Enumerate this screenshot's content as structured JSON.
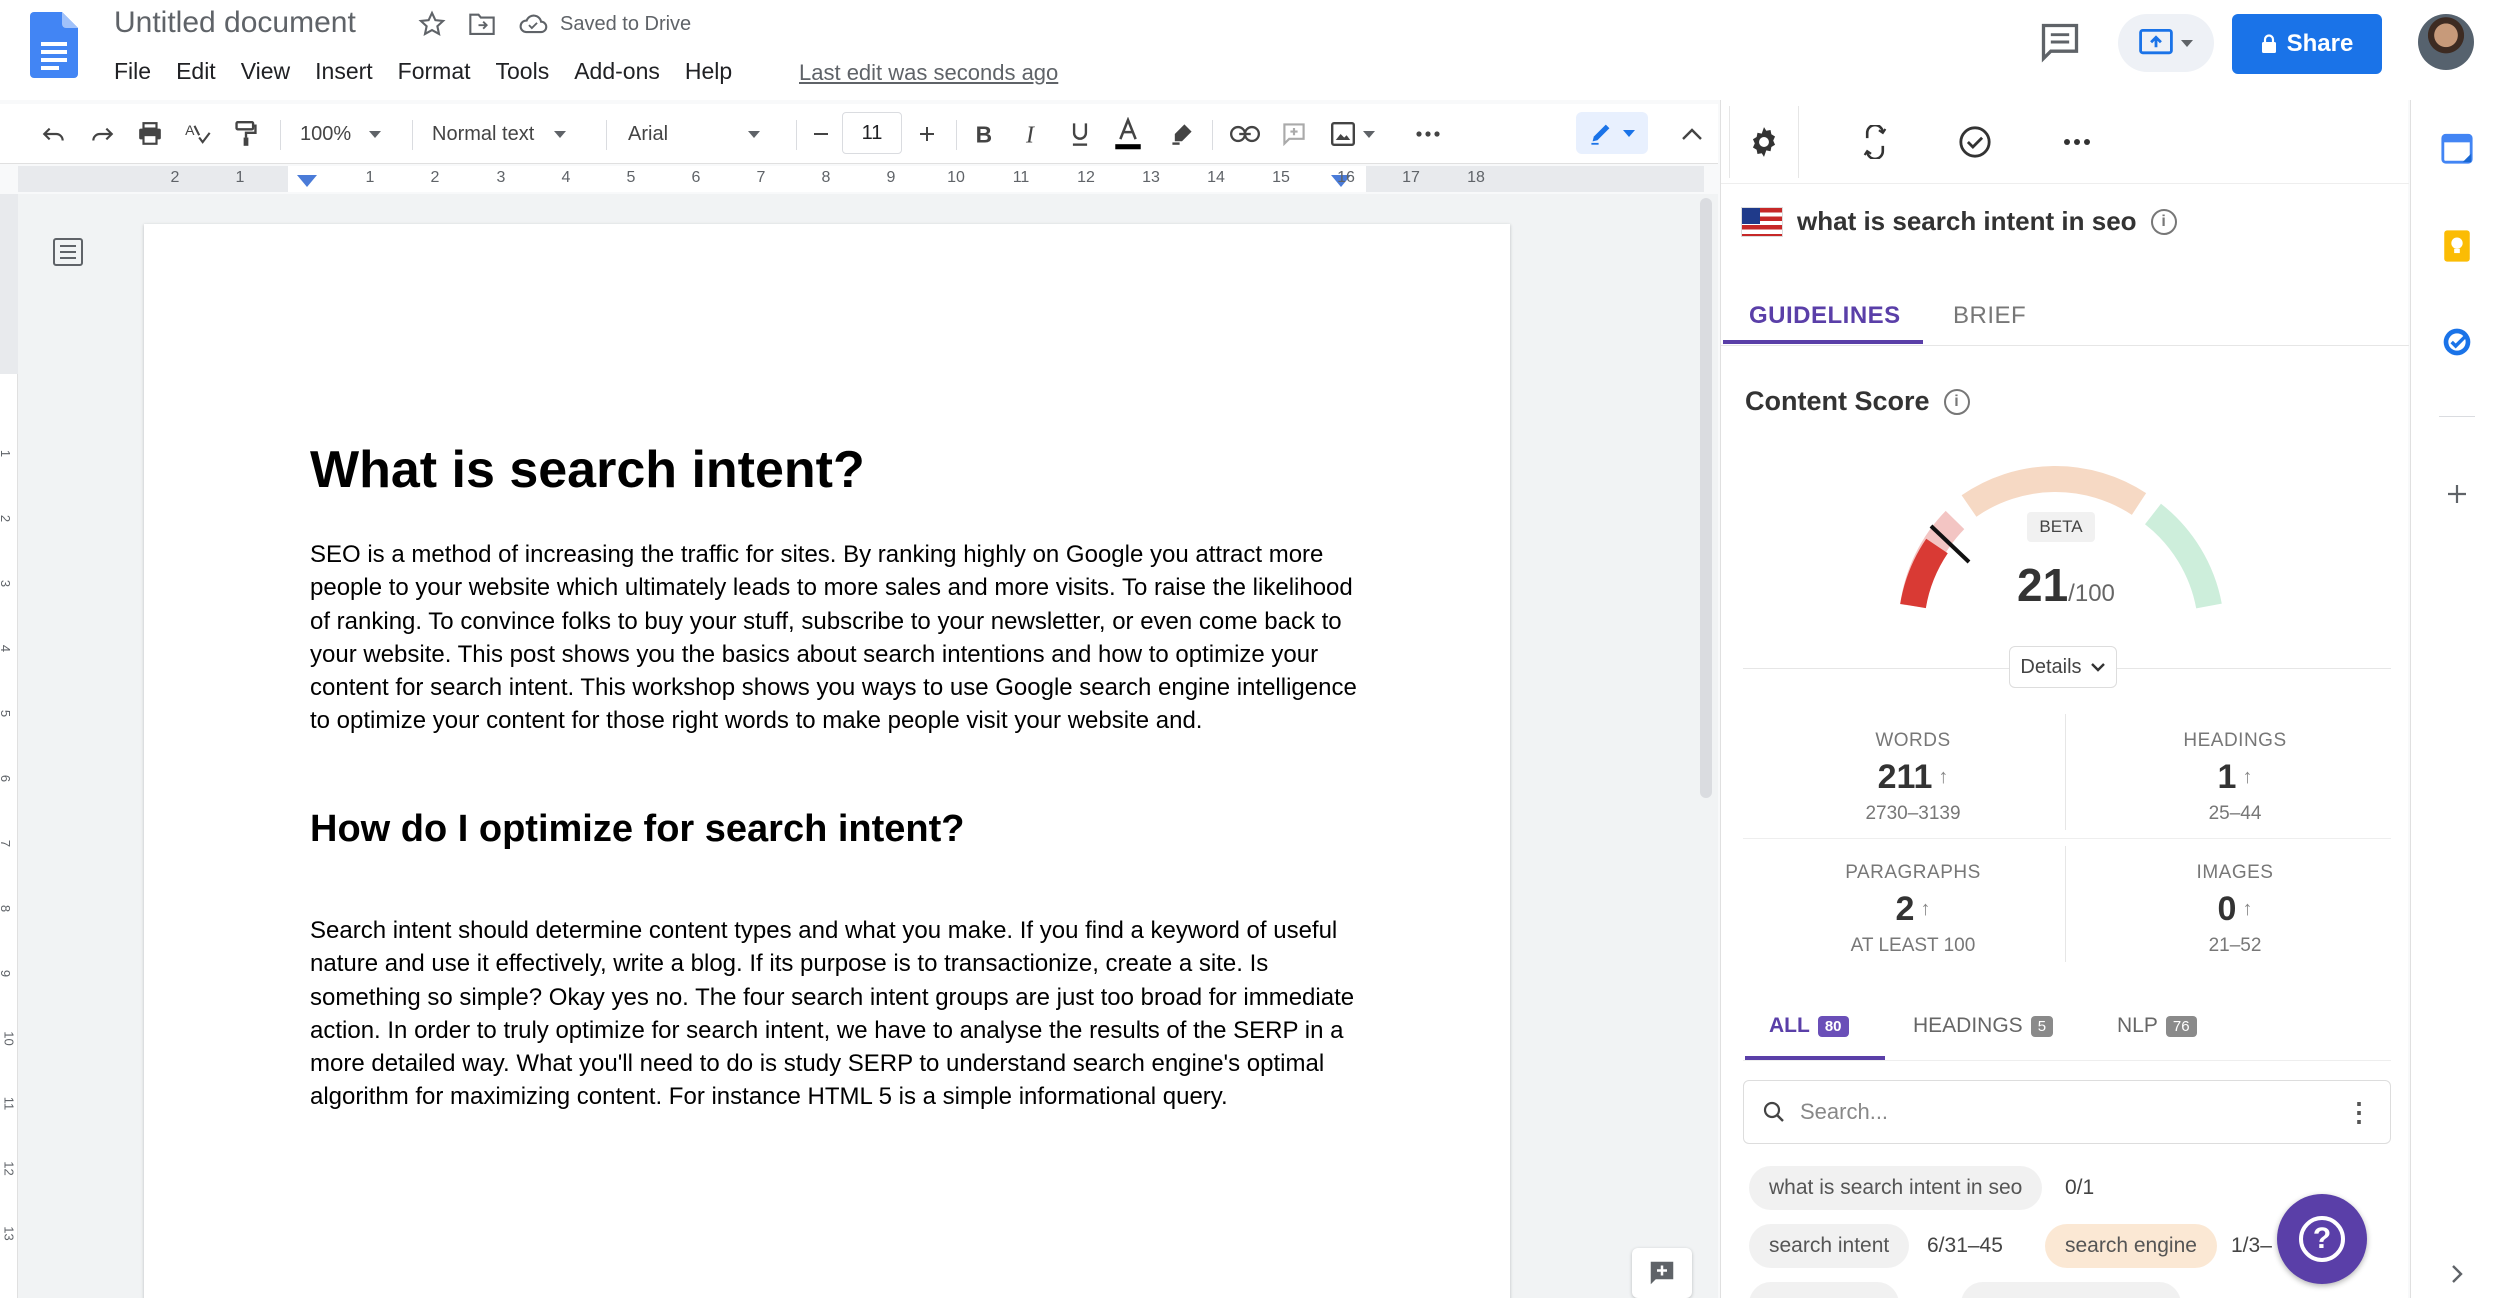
{
  "app": {
    "doc_title": "Untitled document",
    "saved_status": "Saved to Drive",
    "last_edit": "Last edit was seconds ago",
    "share_label": "Share"
  },
  "menu": [
    "File",
    "Edit",
    "View",
    "Insert",
    "Format",
    "Tools",
    "Add-ons",
    "Help"
  ],
  "toolbar": {
    "zoom": "100%",
    "style": "Normal text",
    "font": "Arial",
    "font_size": "11"
  },
  "ruler": {
    "numbers": [
      "2",
      "1",
      "1",
      "2",
      "3",
      "4",
      "5",
      "6",
      "7",
      "8",
      "9",
      "10",
      "11",
      "12",
      "13",
      "14",
      "15",
      "16",
      "17",
      "18"
    ],
    "vertical_numbers": [
      "1",
      "2",
      "3",
      "4",
      "5",
      "6",
      "7",
      "8",
      "9",
      "10",
      "11",
      "12",
      "13"
    ]
  },
  "document": {
    "heading1": "What is search intent?",
    "paragraph1": "SEO is a method of increasing the traffic for sites. By ranking highly on Google you attract more people to your website which ultimately leads to more sales and more visits. To raise the likelihood of ranking. To convince folks to buy your stuff, subscribe to your newsletter, or even come back to your website. This post shows you the basics about search intentions and how to optimize your content for search intent. This workshop shows you ways to use Google search engine intelligence to optimize your content for those right words to make people visit your website and.",
    "heading2": "How do I optimize for search intent?",
    "paragraph2": "Search intent should determine content types and what you make. If you find a keyword of useful nature and use it effectively, write a blog. If its purpose is to transactionize, create a site. Is something so simple? Okay yes no. The four search intent groups are just too broad for immediate action. In order to truly optimize for search intent, we have to analyse the results of the SERP in a more detailed way. What you'll need to do is study SERP to understand search engine's optimal algorithm for maximizing content. For instance HTML 5 is a simple informational query."
  },
  "panel": {
    "keyword": "what is search intent in seo",
    "tabs": [
      "GUIDELINES",
      "BRIEF"
    ],
    "active_tab": "GUIDELINES",
    "content_score_title": "Content Score",
    "beta_label": "BETA",
    "score": "21",
    "score_max": "/100",
    "score_value": 21,
    "details_label": "Details",
    "stats": {
      "words": {
        "label": "WORDS",
        "value": "211",
        "range": "2730–3139"
      },
      "headings": {
        "label": "HEADINGS",
        "value": "1",
        "range": "25–44"
      },
      "paragraphs": {
        "label": "PARAGRAPHS",
        "value": "2",
        "range": "AT LEAST 100"
      },
      "images": {
        "label": "IMAGES",
        "value": "0",
        "range": "21–52"
      }
    },
    "filter_tabs": [
      {
        "label": "ALL",
        "count": "80"
      },
      {
        "label": "HEADINGS",
        "count": "5"
      },
      {
        "label": "NLP",
        "count": "76"
      }
    ],
    "search_placeholder": "Search...",
    "terms": [
      {
        "term": "what is search intent in seo",
        "count": "0/1"
      },
      {
        "term": "search intent",
        "count": "6/31–45"
      },
      {
        "term": "search engine",
        "count": "1/3–"
      }
    ],
    "help_label": "?"
  },
  "colors": {
    "accent_purple": "#5a3fa8",
    "share_blue": "#1a73e8",
    "gauge_red": "#d93a34",
    "gauge_peach": "#f6d9c4",
    "gauge_green": "#cdeedb"
  }
}
